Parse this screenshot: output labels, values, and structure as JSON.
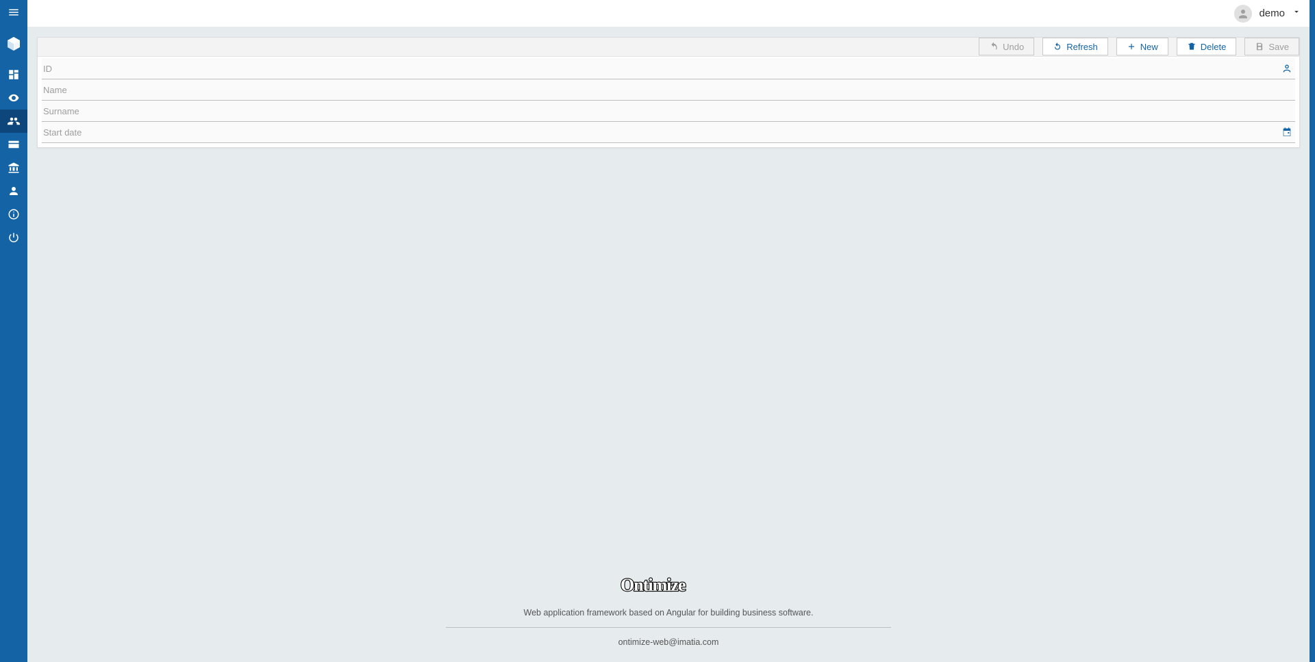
{
  "header": {
    "username": "demo"
  },
  "toolbar": {
    "undo": "Undo",
    "refresh": "Refresh",
    "new": "New",
    "delete": "Delete",
    "save": "Save"
  },
  "form": {
    "fields": {
      "id_label": "ID",
      "name_label": "Name",
      "surname_label": "Surname",
      "startdate_label": "Start date"
    }
  },
  "footer": {
    "brand": "Ontimize",
    "description": "Web application framework based on Angular for building business software.",
    "email": "ontimize-web@imatia.com"
  },
  "sidebar": {
    "items": [
      "dashboard",
      "visibility",
      "customers",
      "cards",
      "bank",
      "employees",
      "info",
      "power"
    ]
  }
}
